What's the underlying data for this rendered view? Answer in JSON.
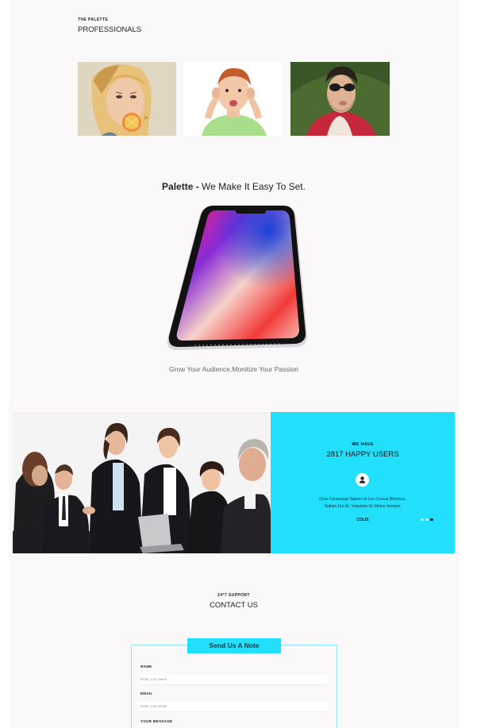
{
  "professionals": {
    "kicker": "THE PALETTE",
    "title": "PROFESSIONALS"
  },
  "promo": {
    "brand": "Palette - ",
    "tagline": "We Make It Easy To Set.",
    "caption": "Grow Your Audience.Monitize Your Passion"
  },
  "stats": {
    "kicker": "WE HAVE",
    "title": "2817 HAPPY USERS",
    "quote_line1": "Orao Consequat Sapien Ut Leo Cursus Rhoncus.",
    "quote_line2": "Nullam Dui Mi, Vulputate Ac Metus Semper.",
    "author": "COLIS",
    "slides": 3,
    "active_slide": 3
  },
  "contact": {
    "kicker": "24*7 SUPPORT",
    "title": "CONTACT US"
  },
  "form": {
    "button": "Send Us A Note",
    "name_label": "NAME",
    "name_placeholder": "Enter your name",
    "email_label": "EMAIL",
    "email_placeholder": "Enter your Email",
    "message_label": "YOUR MESSAGE"
  },
  "colors": {
    "accent": "#22e0fb",
    "background": "#fbf8f9"
  }
}
